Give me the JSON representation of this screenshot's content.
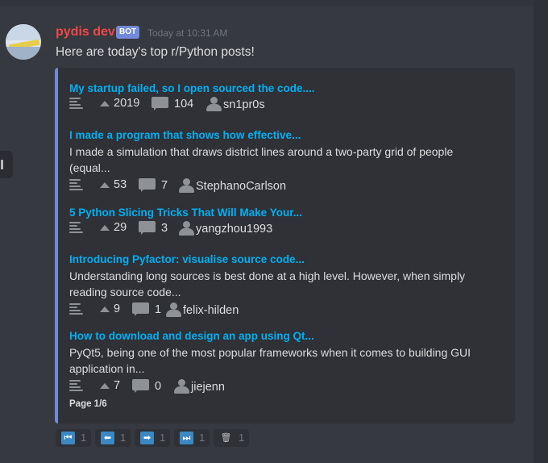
{
  "message": {
    "username": "pydis dev",
    "bot_badge": "BOT",
    "timestamp": "Today at 10:31 AM",
    "text": "Here are today's top r/Python posts!"
  },
  "posts": [
    {
      "title": "My startup failed, so I open sourced the code....",
      "desc": "",
      "votes": "2019",
      "comments": "104",
      "author": "sn1pr0s"
    },
    {
      "title": "I made a program that shows how effective...",
      "desc": "I made a simulation that draws district lines around a two-party grid of people (equal...",
      "votes": "53",
      "comments": "7",
      "author": "StephanoCarlson"
    },
    {
      "title": "5 Python Slicing Tricks That Will Make Your...",
      "desc": "",
      "votes": "29",
      "comments": "3",
      "author": "yangzhou1993"
    },
    {
      "title": "Introducing Pyfactor: visualise source code...",
      "desc": "Understanding long sources is best done at a high level. However, when simply reading source code...",
      "votes": "9",
      "comments": "1",
      "author": "felix-hilden"
    },
    {
      "title": "How to download and design an app using Qt...",
      "desc": "PyQt5, being one of the most popular frameworks when it comes to building GUI application in...",
      "votes": "7",
      "comments": "0",
      "author": "jiejenn"
    }
  ],
  "page_indicator": "Page 1/6",
  "reactions": [
    {
      "icon": "first-page-icon",
      "glyph": "⏮",
      "count": "1"
    },
    {
      "icon": "previous-icon",
      "glyph": "⬅",
      "count": "1"
    },
    {
      "icon": "next-icon",
      "glyph": "➡",
      "count": "1"
    },
    {
      "icon": "last-page-icon",
      "glyph": "⏭",
      "count": "1"
    },
    {
      "icon": "trash-icon",
      "glyph": "🗑",
      "count": "1"
    }
  ],
  "colors": {
    "accent": "#7289da",
    "link": "#00b0f4",
    "username": "#f04747"
  }
}
